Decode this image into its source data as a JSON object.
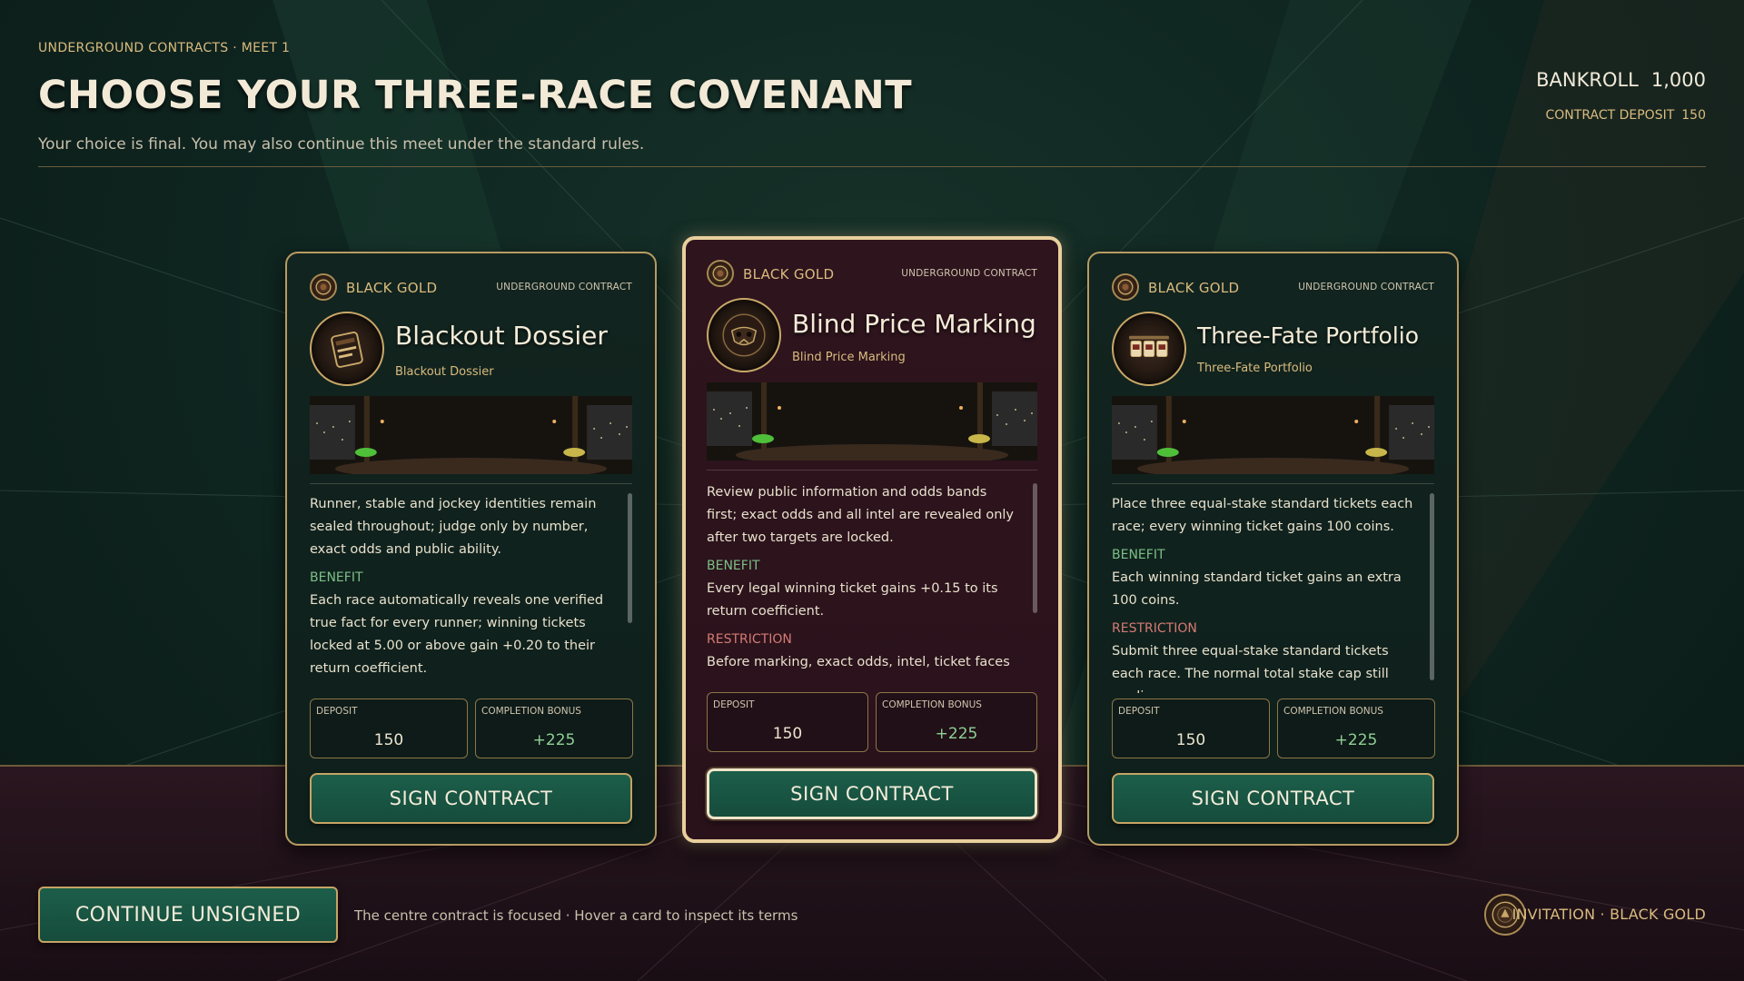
{
  "header": {
    "eyebrow": "UNDERGROUND CONTRACTS · MEET 1",
    "title": "CHOOSE YOUR THREE-RACE COVENANT",
    "subtitle": "Your choice is final. You may also continue this meet under the standard rules.",
    "bankroll_label": "BANKROLL",
    "bankroll_value": "1,000",
    "deposit_label": "CONTRACT DEPOSIT",
    "deposit_value": "150"
  },
  "cards": [
    {
      "brand": "BLACK GOLD",
      "contract_type": "UNDERGROUND CONTRACT",
      "name": "Blackout Dossier",
      "subname": "Blackout Dossier",
      "description": "Runner, stable and jockey identities remain sealed throughout; judge only by number, exact odds and public ability.",
      "benefit_label": "BENEFIT",
      "benefit": "Each race automatically reveals one verified true fact for every runner; winning tickets locked at 5.00 or above gain +0.20 to their return coefficient.",
      "restriction_label": "",
      "restriction": "",
      "deposit_label": "DEPOSIT",
      "deposit": "150",
      "bonus_label": "COMPLETION BONUS",
      "bonus": "+225",
      "sign_label": "SIGN CONTRACT",
      "emblem_icon": "dossier-icon",
      "focused": false
    },
    {
      "brand": "BLACK GOLD",
      "contract_type": "UNDERGROUND CONTRACT",
      "name": "Blind Price Marking",
      "subname": "Blind Price Marking",
      "description": "Review public information and odds bands first; exact odds and all intel are revealed only after two targets are locked.",
      "benefit_label": "BENEFIT",
      "benefit": "Every legal winning ticket gains +0.15 to its return coefficient.",
      "restriction_label": "RESTRICTION",
      "restriction": "Before marking, exact odds, intel, ticket faces",
      "deposit_label": "DEPOSIT",
      "deposit": "150",
      "bonus_label": "COMPLETION BONUS",
      "bonus": "+225",
      "sign_label": "SIGN CONTRACT",
      "emblem_icon": "masked-face-icon",
      "focused": true
    },
    {
      "brand": "BLACK GOLD",
      "contract_type": "UNDERGROUND CONTRACT",
      "name": "Three-Fate Portfolio",
      "subname": "Three-Fate Portfolio",
      "description": "Place three equal-stake standard tickets each race; every winning ticket gains 100 coins.",
      "benefit_label": "BENEFIT",
      "benefit": "Each winning standard ticket gains an extra 100 coins.",
      "restriction_label": "RESTRICTION",
      "restriction": "Submit three equal-stake standard tickets each race. The normal total stake cap still applies.",
      "deposit_label": "DEPOSIT",
      "deposit": "150",
      "bonus_label": "COMPLETION BONUS",
      "bonus": "+225",
      "sign_label": "SIGN CONTRACT",
      "emblem_icon": "three-tickets-icon",
      "focused": false
    }
  ],
  "footer": {
    "continue_label": "CONTINUE UNSIGNED",
    "hint": "The centre contract is focused · Hover a card to inspect its terms",
    "invitation": "INVITATION · BLACK GOLD"
  },
  "colors": {
    "accent_gold": "#d9bb7e",
    "button_green": "#1c5e4a",
    "benefit_green": "#7bbf86",
    "restriction_red": "#d57a74",
    "focused_border": "#e9cf9c"
  }
}
